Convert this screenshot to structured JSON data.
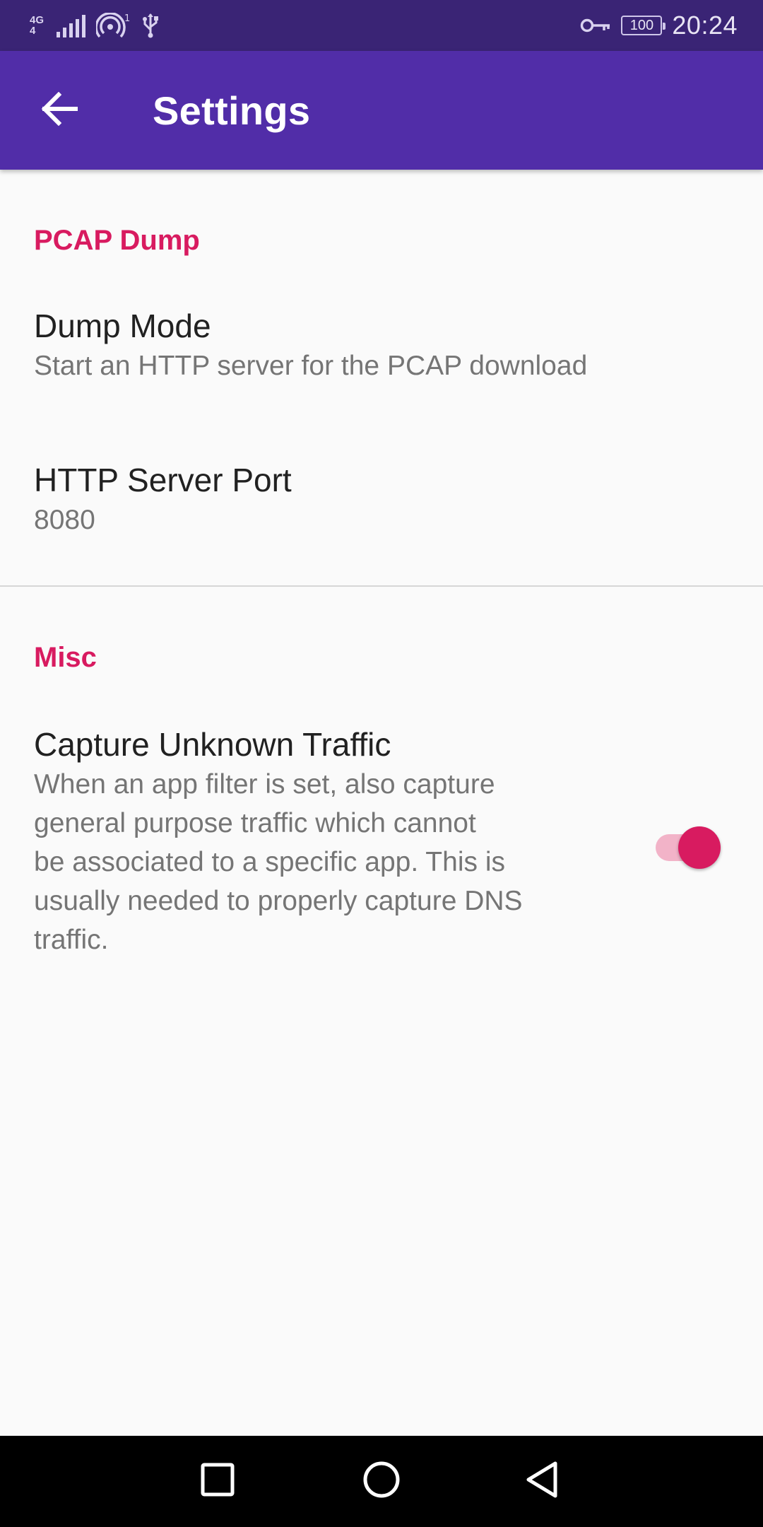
{
  "status_bar": {
    "network_type": "4G",
    "network_sub": "4",
    "hotspot_badge": "1",
    "battery": "100",
    "time": "20:24",
    "icons": [
      "signal-icon",
      "hotspot-icon",
      "usb-icon",
      "vpn-key-icon",
      "battery-icon"
    ]
  },
  "app_bar": {
    "title": "Settings",
    "back_icon": "arrow-back-icon"
  },
  "sections": [
    {
      "title": "PCAP Dump",
      "items": [
        {
          "title": "Dump Mode",
          "summary": "Start an HTTP server for the PCAP download"
        },
        {
          "title": "HTTP Server Port",
          "summary": "8080"
        }
      ]
    },
    {
      "title": "Misc",
      "items": [
        {
          "title": "Capture Unknown Traffic",
          "summary_lines": [
            "When an app filter is set, also capture",
            "general purpose traffic which cannot",
            "be associated to a specific app. This is",
            "usually needed to properly capture DNS",
            "traffic."
          ],
          "switch_on": true
        }
      ]
    }
  ],
  "nav_bar": {
    "recents_icon": "square-icon",
    "home_icon": "circle-icon",
    "back_icon": "triangle-back-icon"
  },
  "colors": {
    "status_bar": "#3a2475",
    "app_bar": "#512da8",
    "accent": "#d81b60",
    "background": "#fafafa"
  }
}
